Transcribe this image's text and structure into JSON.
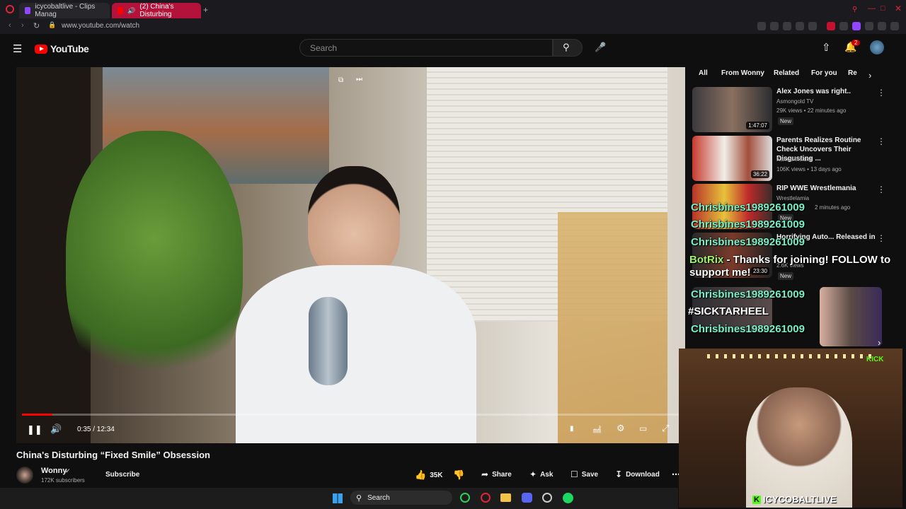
{
  "browser": {
    "tabs": [
      {
        "label": "icycobaltlive - Clips Manag"
      },
      {
        "label": "(2) China's Disturbing"
      }
    ],
    "url": "www.youtube.com/watch",
    "new_tab": "+"
  },
  "youtube": {
    "logo_text": "YouTube",
    "search_placeholder": "Search",
    "notification_count": "2"
  },
  "player": {
    "time": "0:35 / 12:34",
    "progress_fraction": 0.046
  },
  "video": {
    "title": "China's Disturbing “Fixed Smile” Obsession",
    "channel": "Wonny",
    "subscribers": "172K subscribers",
    "subscribe_label": "Subscribe",
    "likes": "35K",
    "share_label": "Share",
    "ask_label": "Ask",
    "save_label": "Save",
    "download_label": "Download"
  },
  "chips": [
    "All",
    "From Wonny",
    "Related",
    "For you",
    "Re"
  ],
  "recommendations": [
    {
      "title": "Alex Jones was right..",
      "channel": "Asmongold TV",
      "meta": "29K views • 22 minutes ago",
      "badge": "New",
      "duration": "1:47:07"
    },
    {
      "title": "Parents Realizes Routine Check Uncovers Their Disgusting ...",
      "channel": "Karma Insider",
      "meta": "106K views • 13 days ago",
      "badge": "",
      "duration": "36:22"
    },
    {
      "title": "RIP WWE Wrestlemania",
      "channel": "Wrestlelamia",
      "meta": "2 minutes ago",
      "badge": "New",
      "duration": ""
    },
    {
      "title": "Horrifying Auto... Released in",
      "channel": "",
      "meta": "2.6K views",
      "badge": "New",
      "duration": "23:30"
    }
  ],
  "chat": [
    {
      "user": "Chrisbines1989261009",
      "msg": ""
    },
    {
      "user": "Chrisbines1989261009",
      "msg": ""
    },
    {
      "user": "Chrisbines1989261009",
      "msg": ""
    },
    {
      "user": "BotRix",
      "msg": "- Thanks for joining! FOLLOW to support me!"
    },
    {
      "user": "Chrisbines1989261009",
      "msg": ""
    },
    {
      "user": "",
      "msg": "#SICKTARHEEL"
    },
    {
      "user": "Chrisbines1989261009",
      "msg": ""
    }
  ],
  "webcam": {
    "streamer_label": "ICYCOBALTLIVE",
    "kick_badge": "KICK"
  },
  "taskbar": {
    "search_label": "Search"
  },
  "colors": {
    "accent_red": "#ff0000",
    "chat_name": "#78f0c8",
    "bot_name": "#a0f070"
  }
}
